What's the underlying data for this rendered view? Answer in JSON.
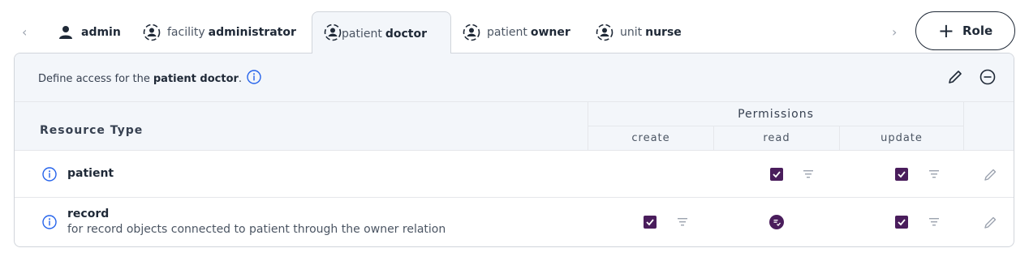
{
  "tabs": [
    {
      "prefix": "",
      "role": "admin",
      "icon": "person-icon"
    },
    {
      "prefix": "facility",
      "role": "administrator",
      "icon": "person-circle-icon"
    },
    {
      "prefix": "patient",
      "role": "doctor",
      "icon": "person-circle-icon",
      "active": true
    },
    {
      "prefix": "patient",
      "role": "owner",
      "icon": "person-circle-icon"
    },
    {
      "prefix": "unit",
      "role": "nurse",
      "icon": "person-circle-icon"
    }
  ],
  "add_role": {
    "label": "Role"
  },
  "panel": {
    "prefix": "Define access for the",
    "role": "patient doctor",
    "suffix": "."
  },
  "table": {
    "resource_header": "Resource Type",
    "permissions_header": "Permissions",
    "columns": [
      "create",
      "read",
      "update"
    ],
    "rows": [
      {
        "name": "patient",
        "description": "",
        "create": "none",
        "read": "checked",
        "update": "checked"
      },
      {
        "name": "record",
        "description": "for record objects connected to patient through the owner relation",
        "create": "checked",
        "read": "derived",
        "update": "checked"
      }
    ]
  },
  "colors": {
    "accent": "#4a1d5c",
    "info": "#2563eb",
    "header_bg": "#f3f6fa"
  }
}
